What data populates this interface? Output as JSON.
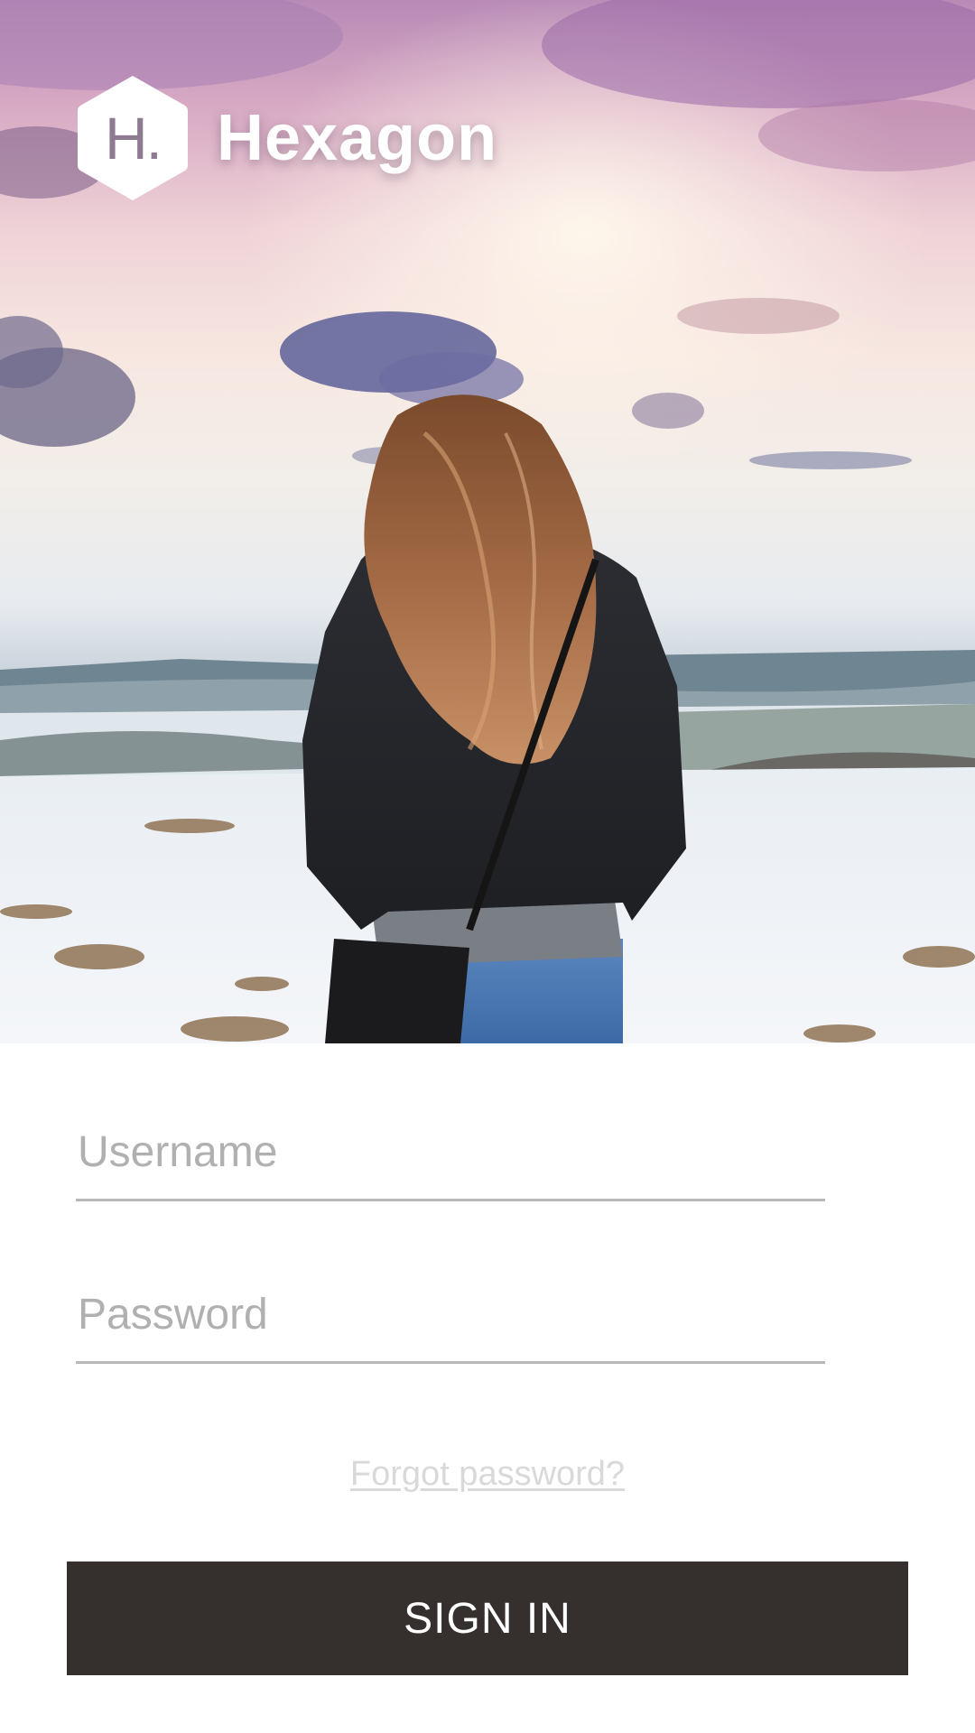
{
  "brand": {
    "logo_letter": "H.",
    "name": "Hexagon"
  },
  "hero": {
    "icon": "landscape-photo"
  },
  "login": {
    "username_placeholder": "Username",
    "password_placeholder": "Password",
    "forgot_label": "Forgot password?",
    "signin_label": "SIGN IN"
  },
  "colors": {
    "button_bg": "#352f2e",
    "button_text": "#ffffff",
    "field_underline": "#b8b8b8",
    "placeholder": "#b0b0b0",
    "forgot_link": "#d9d9d9",
    "sky_purple": "#b88ab6"
  }
}
